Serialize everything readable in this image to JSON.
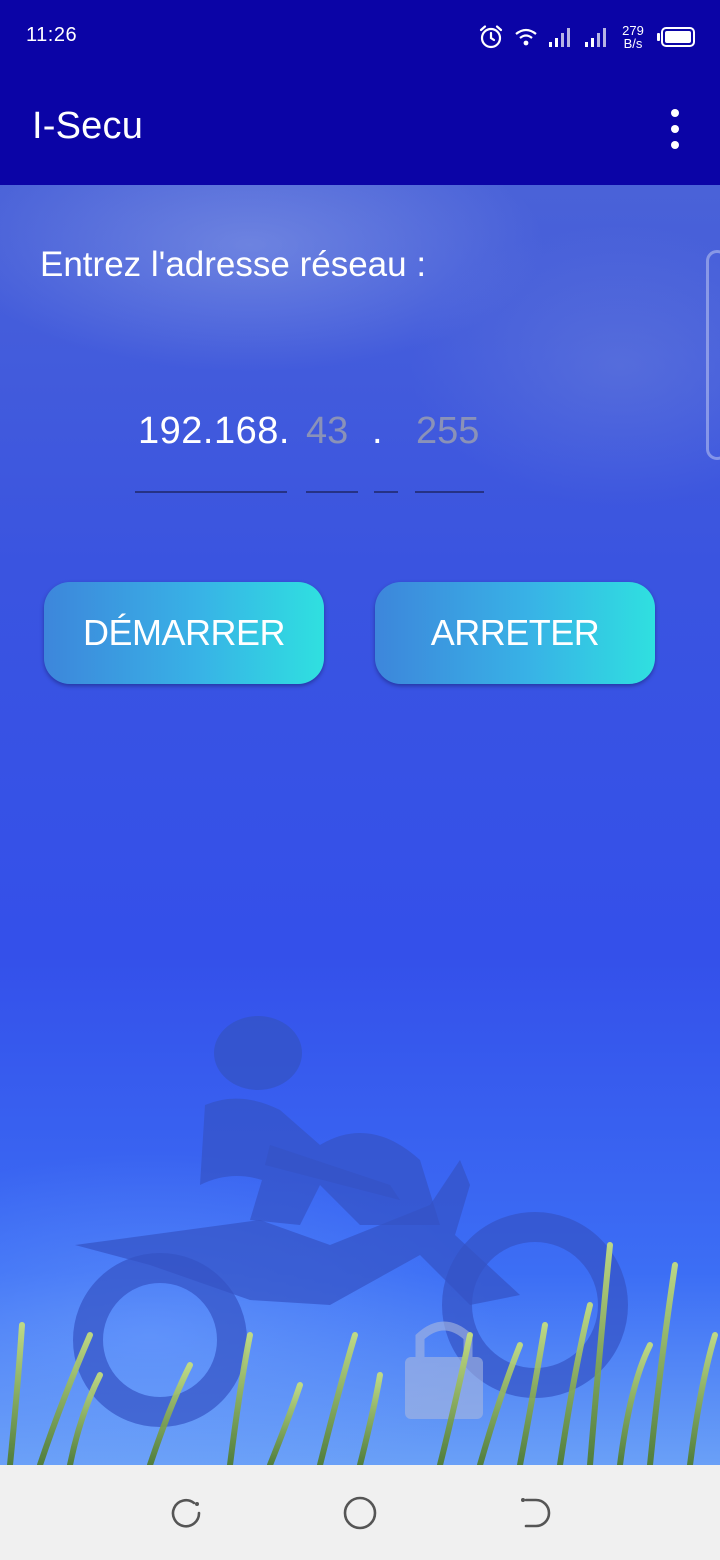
{
  "status_bar": {
    "time": "11:26",
    "speed_value": "279",
    "speed_unit": "B/s",
    "icons": [
      "alarm-icon",
      "wifi-icon",
      "signal-icon",
      "signal-icon",
      "battery-icon"
    ]
  },
  "app_bar": {
    "title": "I-Secu",
    "menu_icon": "more-vert-icon"
  },
  "main": {
    "prompt": "Entrez l'adresse réseau :",
    "ip": {
      "prefix": "192.168.",
      "third_octet_placeholder": "43",
      "separator": ".",
      "fourth_octet_placeholder": "255"
    },
    "buttons": {
      "start": "DÉMARRER",
      "stop": "ARRETER"
    }
  },
  "nav_bar": {
    "icons": [
      "recents-icon",
      "home-icon",
      "back-icon"
    ]
  },
  "colors": {
    "app_bar": "#0b04a6",
    "button_gradient_start": "#3d86db",
    "button_gradient_end": "#2fe0e0",
    "placeholder": "#8a92b8",
    "nav_bar": "#f0f0f0"
  }
}
